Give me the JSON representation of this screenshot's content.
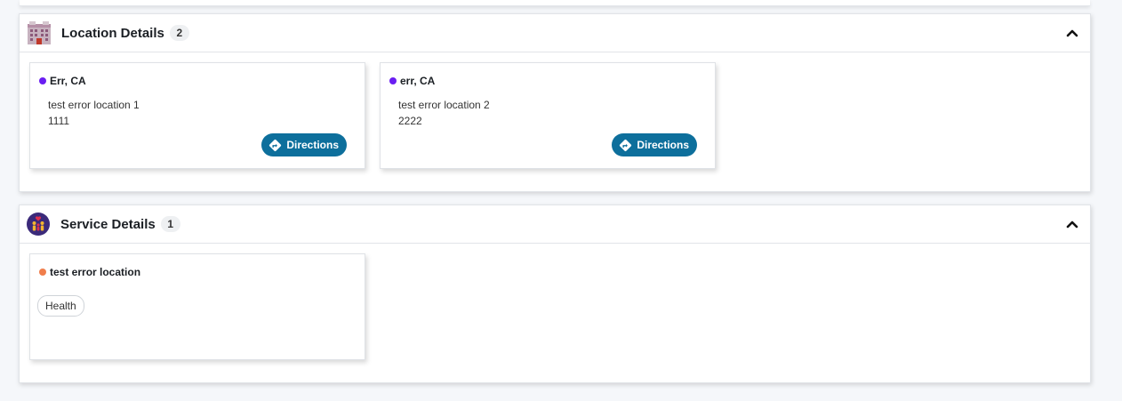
{
  "location_section": {
    "title": "Location Details",
    "count": "2",
    "icon": "building-icon",
    "cards": [
      {
        "title": "Err, CA",
        "dot_color": "#6a1ef2",
        "line1": "test error location 1",
        "line2": "1111",
        "button": "Directions"
      },
      {
        "title": "err, CA",
        "dot_color": "#6a1ef2",
        "line1": "test error location 2",
        "line2": "2222",
        "button": "Directions"
      }
    ]
  },
  "service_section": {
    "title": "Service Details",
    "count": "1",
    "icon": "people-icon",
    "cards": [
      {
        "title": "test error location",
        "dot_color": "#f07e4c",
        "tag": "Health"
      }
    ]
  },
  "colors": {
    "accent": "#0d6f9c",
    "location_dot": "#6a1ef2",
    "service_dot": "#f07e4c"
  }
}
